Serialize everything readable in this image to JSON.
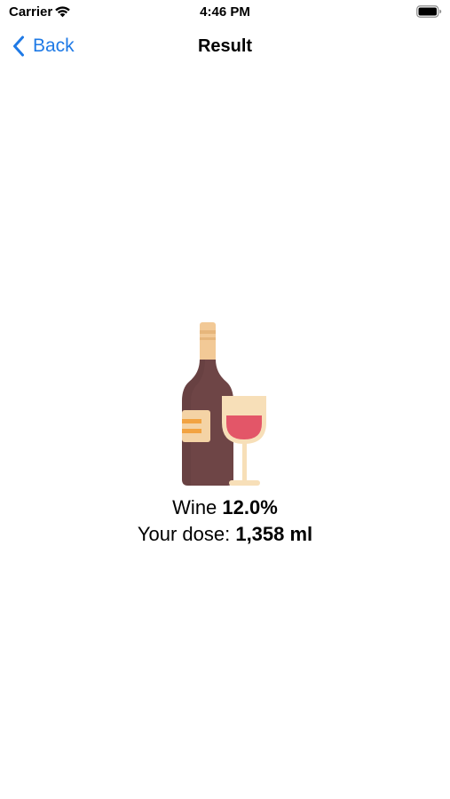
{
  "status_bar": {
    "carrier": "Carrier",
    "time": "4:46 PM"
  },
  "nav": {
    "back_label": "Back",
    "title": "Result"
  },
  "result": {
    "drink_name": "Wine",
    "abv": "12.0%",
    "dose_label": "Your dose:",
    "dose_value": "1,358 ml"
  },
  "colors": {
    "accent": "#1f7ae6",
    "bottle": "#6e4546",
    "bottle_cap": "#f2c996",
    "label": "#f4d3a5",
    "label_stripe": "#f2a341",
    "glass": "#f7dfb8",
    "wine": "#e35668"
  },
  "icons": {
    "wifi": "wifi-icon",
    "battery": "battery-icon",
    "back": "chevron-left-icon",
    "illustration": "wine-bottle-and-glass-icon"
  }
}
